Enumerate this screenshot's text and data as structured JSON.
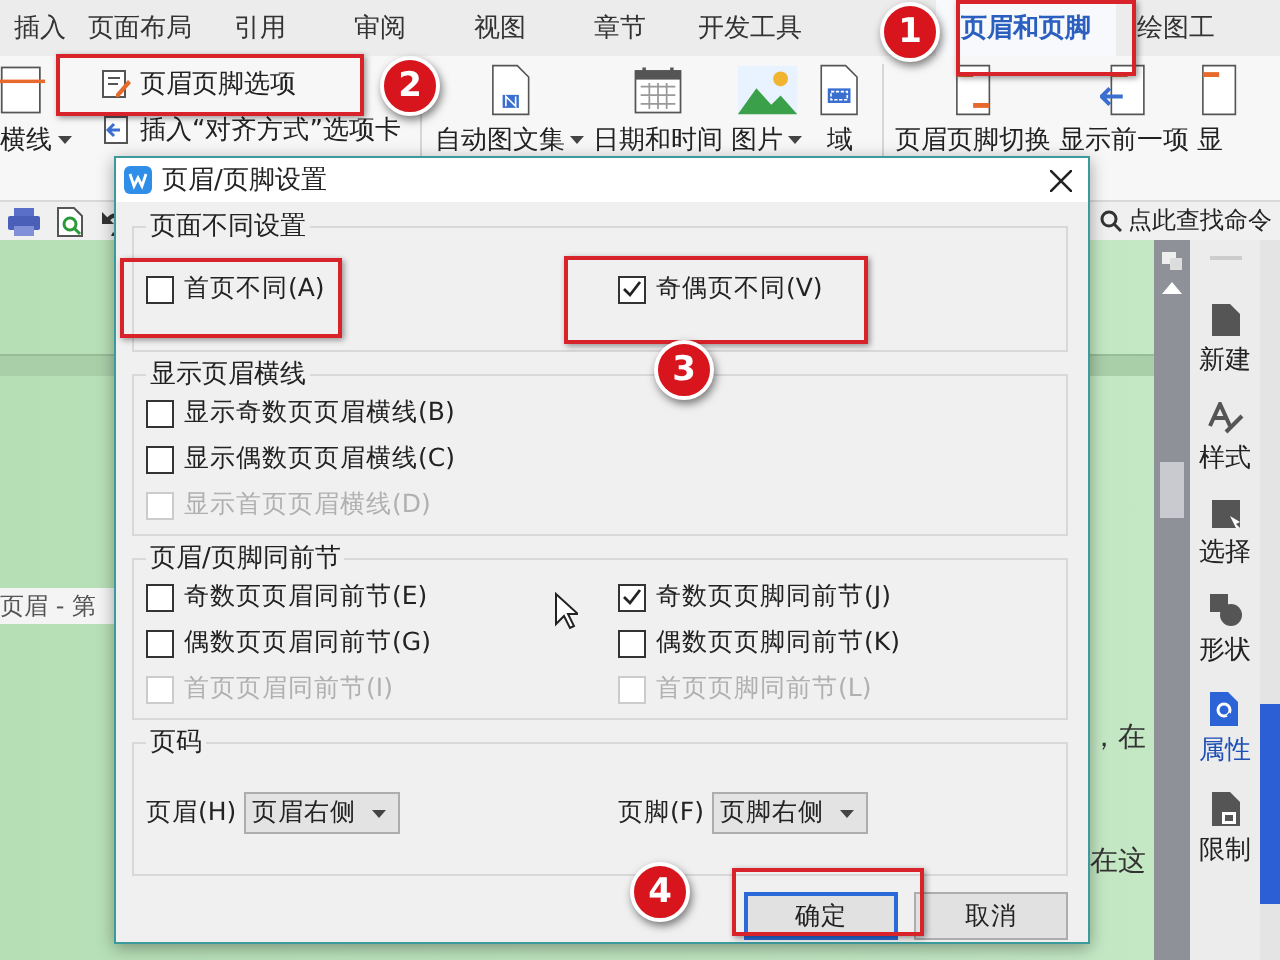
{
  "ribbon_tabs": [
    {
      "label": "插入",
      "selected": false
    },
    {
      "label": "页面布局",
      "selected": false
    },
    {
      "label": "引用",
      "selected": false
    },
    {
      "label": "审阅",
      "selected": false
    },
    {
      "label": "视图",
      "selected": false
    },
    {
      "label": "章节",
      "selected": false
    },
    {
      "label": "开发工具",
      "selected": false
    },
    {
      "label": "页眉和页脚",
      "selected": true
    },
    {
      "label": "绘图工",
      "selected": false
    }
  ],
  "ribbon": {
    "line_tool": {
      "label": "横线",
      "dropdown": true
    },
    "small_tools": [
      {
        "label": "页眉页脚选项"
      },
      {
        "label": "插入“对齐方式”选项卡"
      }
    ],
    "insert_tools": [
      {
        "label": "自动图文集",
        "dropdown": true
      },
      {
        "label": "日期和时间",
        "dropdown": false
      },
      {
        "label": "图片",
        "dropdown": true
      },
      {
        "label": "域",
        "dropdown": false
      }
    ],
    "nav_tools": [
      {
        "label": "页眉页脚切换"
      },
      {
        "label": "显示前一项"
      },
      {
        "label": "显"
      }
    ]
  },
  "command_search": {
    "placeholder": "点此查找命令"
  },
  "document": {
    "header_tag": "页眉 - 第",
    "fragments": [
      "，在",
      "在这"
    ]
  },
  "side_panel": [
    {
      "label": "新建",
      "selected": false
    },
    {
      "label": "样式",
      "selected": false
    },
    {
      "label": "选择",
      "selected": false
    },
    {
      "label": "形状",
      "selected": false
    },
    {
      "label": "属性",
      "selected": true
    },
    {
      "label": "限制",
      "selected": false
    }
  ],
  "dialog": {
    "title": "页眉/页脚设置",
    "groups": [
      {
        "title": "页面不同设置",
        "columns": [
          [
            {
              "label": "首页不同(A)",
              "checked": false,
              "disabled": false
            }
          ],
          [
            {
              "label": "奇偶页不同(V)",
              "checked": true,
              "disabled": false
            }
          ]
        ]
      },
      {
        "title": "显示页眉横线",
        "columns": [
          [
            {
              "label": "显示奇数页页眉横线(B)",
              "checked": false,
              "disabled": false
            },
            {
              "label": "显示偶数页页眉横线(C)",
              "checked": false,
              "disabled": false
            },
            {
              "label": "显示首页页眉横线(D)",
              "checked": false,
              "disabled": true
            }
          ]
        ]
      },
      {
        "title": "页眉/页脚同前节",
        "columns": [
          [
            {
              "label": "奇数页页眉同前节(E)",
              "checked": false,
              "disabled": false
            },
            {
              "label": "偶数页页眉同前节(G)",
              "checked": false,
              "disabled": false
            },
            {
              "label": "首页页眉同前节(I)",
              "checked": false,
              "disabled": true
            }
          ],
          [
            {
              "label": "奇数页页脚同前节(J)",
              "checked": true,
              "disabled": false
            },
            {
              "label": "偶数页页脚同前节(K)",
              "checked": false,
              "disabled": false
            },
            {
              "label": "首页页脚同前节(L)",
              "checked": false,
              "disabled": true
            }
          ]
        ]
      }
    ],
    "page_number": {
      "title": "页码",
      "fields": [
        {
          "label": "页眉(H)",
          "value": "页眉右侧"
        },
        {
          "label": "页脚(F)",
          "value": "页脚右侧"
        }
      ]
    },
    "buttons": [
      {
        "label": "确定",
        "default": true
      },
      {
        "label": "取消",
        "default": false
      }
    ]
  },
  "annotations": [
    {
      "number": "1"
    },
    {
      "number": "2"
    },
    {
      "number": "3"
    },
    {
      "number": "4"
    }
  ]
}
